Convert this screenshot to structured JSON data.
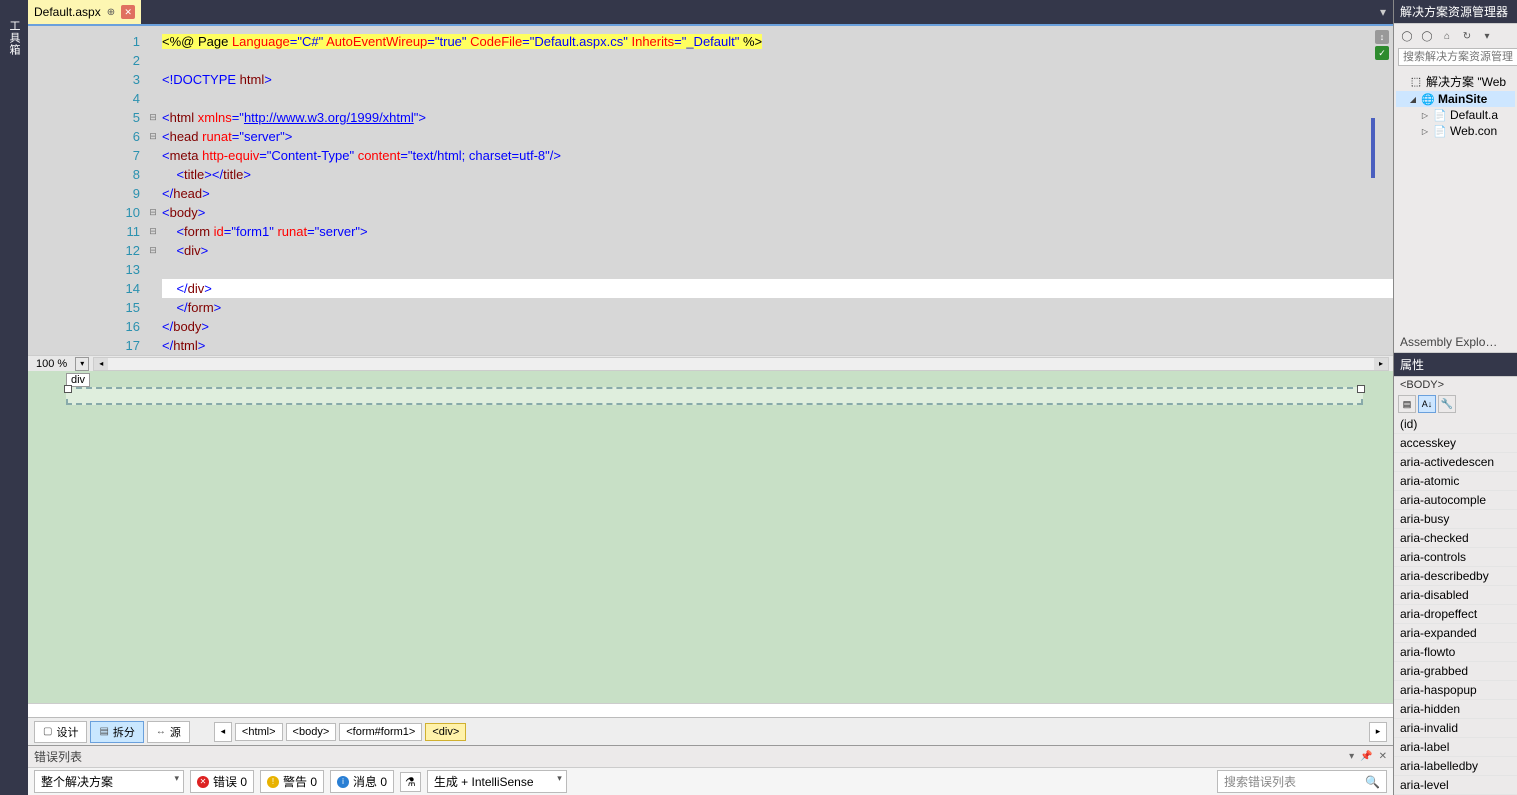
{
  "left_strip": "工具箱",
  "tab": {
    "label": "Default.aspx"
  },
  "code": {
    "lines": [
      1,
      2,
      3,
      4,
      5,
      6,
      7,
      8,
      9,
      10,
      11,
      12,
      13,
      14,
      15,
      16,
      17
    ],
    "line1": {
      "a": "<%",
      "b": "@ Page ",
      "c": "Language",
      "d": "=\"C#\"",
      "e": " AutoEventWireup",
      "f": "=\"true\"",
      "g": " CodeFile",
      "h": "=\"Default.aspx.cs\"",
      "i": " Inherits",
      "j": "=\"_Default\"",
      "k": " %>"
    },
    "line3": {
      "a": "<!",
      "b": "DOCTYPE",
      "c": " html",
      "d": ">"
    },
    "line5": {
      "a": "<",
      "b": "html",
      "c": " xmlns",
      "d": "=\"",
      "e": "http://www.w3.org/1999/xhtml",
      "f": "\">"
    },
    "line6": {
      "a": "<",
      "b": "head",
      "c": " runat",
      "d": "=\"server\">"
    },
    "line7": {
      "a": "<",
      "b": "meta",
      "c": " http-equiv",
      "d": "=\"Content-Type\"",
      "e": " content",
      "f": "=\"text/html; charset=utf-8\"/>"
    },
    "line8": {
      "a": "    <",
      "b": "title",
      "c": "></",
      "d": "title",
      "e": ">"
    },
    "line9": {
      "a": "</",
      "b": "head",
      "c": ">"
    },
    "line10": {
      "a": "<",
      "b": "body",
      "c": ">"
    },
    "line11": {
      "a": "    <",
      "b": "form",
      "c": " id",
      "d": "=\"form1\"",
      "e": " runat",
      "f": "=\"server\">"
    },
    "line12": {
      "a": "    <",
      "b": "div",
      "c": ">"
    },
    "line14": {
      "a": "    </",
      "b": "div",
      "c": ">"
    },
    "line15": {
      "a": "    </",
      "b": "form",
      "c": ">"
    },
    "line16": {
      "a": "</",
      "b": "body",
      "c": ">"
    },
    "line17": {
      "a": "</",
      "b": "html",
      "c": ">"
    }
  },
  "zoom": "100 %",
  "preview_tag": "div",
  "viewbar": {
    "design": "设计",
    "split": "拆分",
    "source": "源",
    "crumbs": [
      "<html>",
      "<body>",
      "<form#form1>",
      "<div>"
    ]
  },
  "errorlist": {
    "title": "错误列表",
    "scope": "整个解决方案",
    "errors": "错误 0",
    "warnings": "警告 0",
    "messages": "消息 0",
    "build": "生成 + IntelliSense",
    "search_placeholder": "搜索错误列表"
  },
  "solution_explorer": {
    "title": "解决方案资源管理器",
    "search_placeholder": "搜索解决方案资源管理",
    "root": "解决方案  \"Web",
    "project": "MainSite",
    "file1": "Default.a",
    "file2": "Web.con"
  },
  "assembly_panel": "Assembly Explo…",
  "properties": {
    "title": "属性",
    "obj": "<BODY>",
    "items": [
      "(id)",
      "accesskey",
      "aria-activedescen",
      "aria-atomic",
      "aria-autocomple",
      "aria-busy",
      "aria-checked",
      "aria-controls",
      "aria-describedby",
      "aria-disabled",
      "aria-dropeffect",
      "aria-expanded",
      "aria-flowto",
      "aria-grabbed",
      "aria-haspopup",
      "aria-hidden",
      "aria-invalid",
      "aria-label",
      "aria-labelledby",
      "aria-level"
    ]
  }
}
